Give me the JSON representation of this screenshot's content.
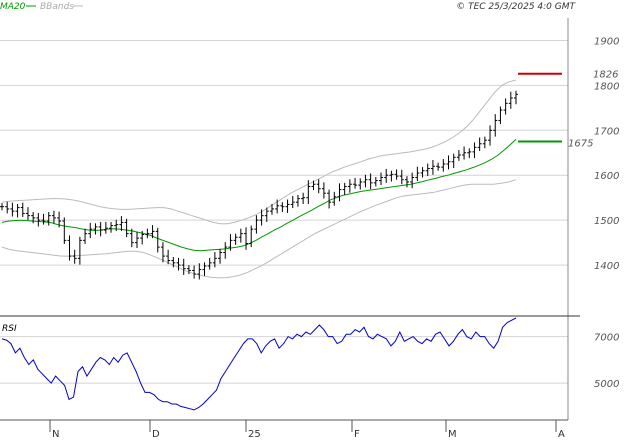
{
  "header": {
    "legend": [
      {
        "name": "MA20",
        "color": "#009900"
      },
      {
        "name": "BBands",
        "color": "#bbbbbb"
      }
    ],
    "credit": "© TEC 25/3/2025 4:0 GMT"
  },
  "chart_data": {
    "type": "line",
    "price_panel": {
      "ylim": [
        1300,
        1950
      ],
      "y_ticks": [
        1400,
        1500,
        1600,
        1700,
        1800,
        1900
      ],
      "grid": true,
      "markers": [
        {
          "label": "1826",
          "value": 1826,
          "color": "#cc0000"
        },
        {
          "label": "1675",
          "value": 1675,
          "color": "#009900"
        }
      ],
      "series": [
        {
          "name": "Price",
          "type": "ohlc-bars",
          "color": "#000000",
          "values": [
            1530,
            1525,
            1520,
            1528,
            1515,
            1510,
            1505,
            1500,
            1498,
            1510,
            1505,
            1498,
            1455,
            1420,
            1415,
            1455,
            1470,
            1480,
            1485,
            1478,
            1482,
            1488,
            1490,
            1495,
            1470,
            1450,
            1460,
            1468,
            1470,
            1475,
            1440,
            1420,
            1410,
            1405,
            1400,
            1392,
            1388,
            1380,
            1390,
            1398,
            1405,
            1415,
            1428,
            1440,
            1455,
            1462,
            1470,
            1448,
            1480,
            1500,
            1510,
            1520,
            1525,
            1532,
            1530,
            1535,
            1540,
            1548,
            1550,
            1575,
            1580,
            1570,
            1560,
            1540,
            1552,
            1568,
            1575,
            1580,
            1578,
            1585,
            1590,
            1583,
            1588,
            1595,
            1600,
            1602,
            1598,
            1590,
            1585,
            1595,
            1605,
            1610,
            1615,
            1620,
            1618,
            1625,
            1630,
            1640,
            1645,
            1650,
            1652,
            1662,
            1670,
            1678,
            1700,
            1722,
            1745,
            1760,
            1772,
            1780
          ]
        },
        {
          "name": "MA20",
          "type": "line",
          "color": "#009900",
          "values": [
            1495,
            1498,
            1499,
            1500,
            1499,
            1498,
            1497,
            1496,
            1494,
            1490,
            1487,
            1485,
            1483,
            1480,
            1478,
            1477,
            1478,
            1480,
            1481,
            1480,
            1478,
            1476,
            1473,
            1470,
            1466,
            1460,
            1455,
            1450,
            1445,
            1440,
            1436,
            1433,
            1432,
            1433,
            1434,
            1435,
            1436,
            1438,
            1440,
            1443,
            1448,
            1455,
            1463,
            1470,
            1478,
            1485,
            1493,
            1500,
            1508,
            1515,
            1522,
            1530,
            1537,
            1545,
            1550,
            1555,
            1558,
            1561,
            1564,
            1566,
            1568,
            1570,
            1572,
            1574,
            1576,
            1578,
            1580,
            1583,
            1586,
            1590,
            1593,
            1597,
            1600,
            1604,
            1608,
            1612,
            1617,
            1622,
            1628,
            1635,
            1644,
            1655,
            1667,
            1680
          ]
        },
        {
          "name": "BBands-upper",
          "type": "line",
          "color": "#bbbbbb",
          "values": [
            1540,
            1542,
            1543,
            1544,
            1545,
            1546,
            1547,
            1548,
            1548,
            1547,
            1545,
            1542,
            1538,
            1534,
            1530,
            1527,
            1525,
            1524,
            1524,
            1525,
            1526,
            1527,
            1528,
            1528,
            1525,
            1520,
            1515,
            1510,
            1505,
            1500,
            1495,
            1492,
            1492,
            1495,
            1500,
            1505,
            1512,
            1520,
            1530,
            1540,
            1550,
            1560,
            1568,
            1576,
            1584,
            1592,
            1600,
            1608,
            1614,
            1620,
            1625,
            1630,
            1636,
            1640,
            1644,
            1646,
            1648,
            1650,
            1652,
            1655,
            1658,
            1662,
            1668,
            1675,
            1684,
            1695,
            1708,
            1725,
            1745,
            1765,
            1785,
            1800,
            1808,
            1812
          ]
        },
        {
          "name": "BBands-lower",
          "type": "line",
          "color": "#bbbbbb",
          "values": [
            1440,
            1435,
            1432,
            1430,
            1428,
            1426,
            1424,
            1422,
            1420,
            1420,
            1421,
            1422,
            1423,
            1424,
            1425,
            1427,
            1429,
            1431,
            1431,
            1428,
            1422,
            1415,
            1408,
            1400,
            1392,
            1385,
            1380,
            1376,
            1373,
            1372,
            1372,
            1374,
            1378,
            1384,
            1392,
            1400,
            1410,
            1420,
            1430,
            1440,
            1450,
            1460,
            1470,
            1478,
            1486,
            1494,
            1502,
            1510,
            1518,
            1525,
            1532,
            1538,
            1544,
            1550,
            1554,
            1556,
            1558,
            1560,
            1562,
            1566,
            1570,
            1574,
            1578,
            1580,
            1580,
            1580,
            1580,
            1582,
            1585,
            1590
          ]
        }
      ]
    },
    "rsi_panel": {
      "title": "RSI",
      "ylim": [
        3500,
        7800
      ],
      "y_ticks": [
        5000,
        7000
      ],
      "tick_labels": [
        "5000",
        "7000"
      ],
      "series": [
        {
          "name": "RSI",
          "color": "#0000cc",
          "values": [
            6900,
            6850,
            6700,
            6300,
            6500,
            6100,
            5800,
            6000,
            5600,
            5400,
            5200,
            5000,
            5300,
            5100,
            4900,
            4300,
            4400,
            5500,
            5700,
            5300,
            5600,
            5900,
            6100,
            6000,
            5800,
            6100,
            5900,
            6200,
            6300,
            5900,
            5500,
            5000,
            4600,
            4600,
            4500,
            4300,
            4200,
            4200,
            4100,
            4100,
            4000,
            3950,
            3900,
            3850,
            3950,
            4100,
            4300,
            4500,
            4700,
            5200,
            5500,
            5800,
            6100,
            6400,
            6700,
            6900,
            6900,
            6700,
            6300,
            6600,
            6800,
            6900,
            6500,
            6700,
            7000,
            6900,
            7100,
            7000,
            7200,
            7100,
            7300,
            7500,
            7300,
            7000,
            7000,
            6700,
            6800,
            7100,
            7100,
            7300,
            7200,
            7400,
            7000,
            6900,
            7100,
            7000,
            6900,
            6600,
            6800,
            7200,
            6800,
            6900,
            7000,
            6800,
            6700,
            6900,
            6800,
            7100,
            7200,
            6900,
            6600,
            6800,
            7100,
            7300,
            7000,
            6900,
            7200,
            7000,
            7000,
            6700,
            6500,
            6800,
            7400,
            7600,
            7700,
            7800
          ]
        }
      ]
    },
    "x_axis": {
      "labels": [
        {
          "text": "N",
          "index": 5
        },
        {
          "text": "D",
          "index": 18
        },
        {
          "text": "25",
          "index": 30
        },
        {
          "text": "F",
          "index": 42
        },
        {
          "text": "M",
          "index": 53
        },
        {
          "text": "A",
          "index": 66
        }
      ],
      "count": 70
    }
  }
}
